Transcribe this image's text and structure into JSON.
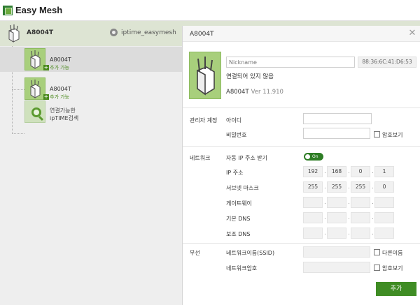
{
  "app": {
    "title": "Easy Mesh"
  },
  "tree": {
    "root": {
      "label": "A8004T",
      "ssid": "iptime_easymesh"
    },
    "nodes": [
      {
        "label": "A8004T",
        "add": "추가 가능"
      },
      {
        "label": "A8004T",
        "add": "추가 가능"
      }
    ],
    "find": {
      "line1": "연결가능한",
      "line2": "ipTIME검색"
    }
  },
  "dialog": {
    "title": "A8004T",
    "nickname_placeholder": "Nickname",
    "mac": "88:36:6C:41:D6:53",
    "status": "연결되어 있지 않음",
    "model": "A8004T",
    "version": "Ver 11.910",
    "admin": {
      "section": "관리자 계정",
      "id_label": "아이디",
      "pw_label": "비밀번호",
      "show_pw": "암호보기"
    },
    "network": {
      "section": "네트워크",
      "auto_ip": "자동 IP 주소 받기",
      "toggle": "On",
      "ip_label": "IP 주소",
      "ip": [
        "192",
        "168",
        "0",
        "1"
      ],
      "mask_label": "서브넷 마스크",
      "mask": [
        "255",
        "255",
        "255",
        "0"
      ],
      "gateway_label": "게이트웨이",
      "dns1_label": "기본 DNS",
      "dns2_label": "보조 DNS"
    },
    "wireless": {
      "section": "무선",
      "ssid_label": "네트워크이름(SSID)",
      "ssid_other": "다른이름",
      "pw_label": "네트워크암호",
      "show_pw": "암호보기"
    },
    "add_button": "추가"
  }
}
